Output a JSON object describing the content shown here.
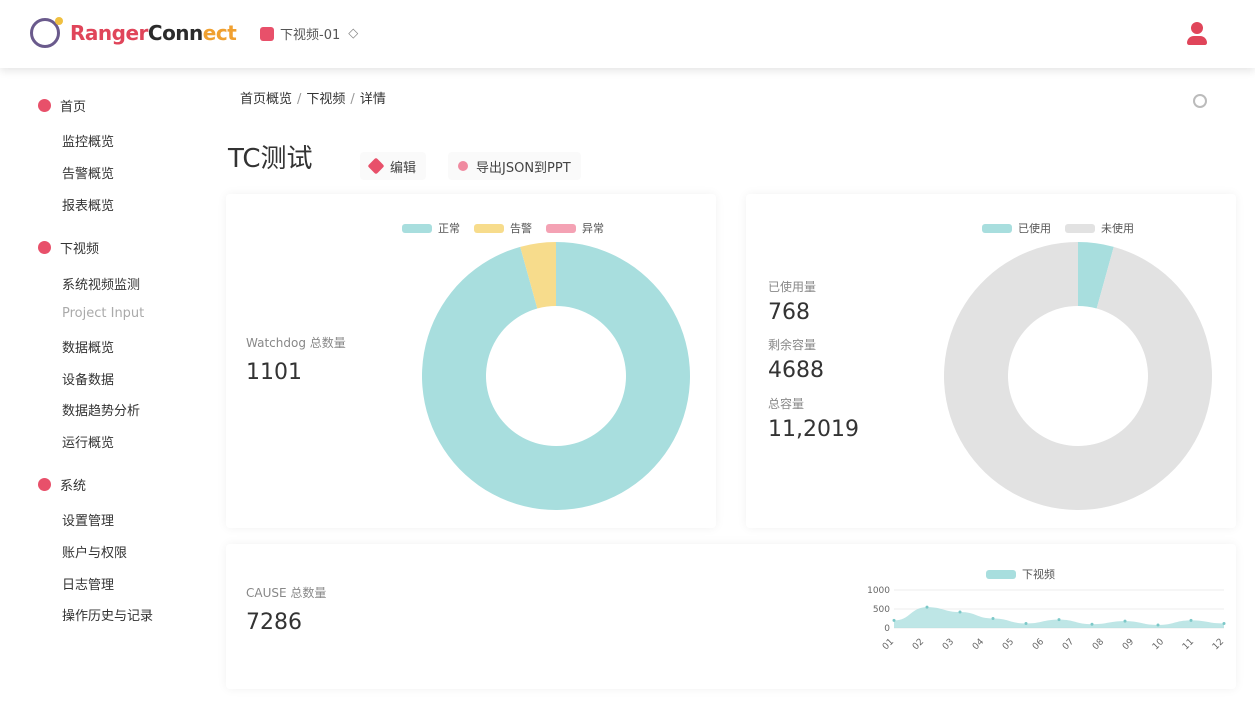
{
  "header": {
    "logo": {
      "part_a": "Ranger",
      "part_b": "Conn",
      "part_c": "ect"
    },
    "project_label": "下视频-01"
  },
  "sidebar": {
    "groups": [
      {
        "label": "首页",
        "items": [
          "监控概览",
          "告警概览",
          "报表概览"
        ]
      },
      {
        "label": "下视频",
        "items": [
          "系统视频监测",
          "Project Input",
          "数据概览",
          "设备数据",
          "数据趋势分析",
          "运行概览"
        ]
      },
      {
        "label": "系统",
        "items": [
          "设置管理",
          "账户与权限",
          "日志管理",
          "操作历史与记录"
        ]
      }
    ]
  },
  "breadcrumb": [
    "首页概览",
    "下视频",
    "详情"
  ],
  "page": {
    "title": "TC测试",
    "button_edit": "编辑",
    "button_export": "导出JSON到PPT"
  },
  "card_a": {
    "legend": [
      {
        "label": "正常",
        "color": "#a8dede"
      },
      {
        "label": "告警",
        "color": "#f7dc8c"
      },
      {
        "label": "异常",
        "color": "#f4a2b4"
      }
    ],
    "stat_label": "Watchdog 总数量",
    "stat_value": "1101",
    "donut": [
      {
        "name": "正常",
        "value": 95.7,
        "color": "#a8dede"
      },
      {
        "name": "告警",
        "value": 4.3,
        "color": "#f7dc8c"
      },
      {
        "name": "异常",
        "value": 0,
        "color": "#f4a2b4"
      }
    ]
  },
  "card_b": {
    "legend": [
      {
        "label": "已使用",
        "color": "#a8dede"
      },
      {
        "label": "未使用",
        "color": "#e2e2e2"
      }
    ],
    "stats": [
      {
        "label": "已使用量",
        "value": "768"
      },
      {
        "label": "剩余容量",
        "value": "4688"
      },
      {
        "label": "总容量",
        "value": "11,2019"
      }
    ],
    "donut": [
      {
        "name": "已使用",
        "value": 4.3,
        "color": "#a8dede"
      },
      {
        "name": "未使用",
        "value": 95.7,
        "color": "#e2e2e2"
      }
    ]
  },
  "card_c": {
    "stat_label": "CAUSE 总数量",
    "stat_value": "7286",
    "chart_legend": "下视频"
  },
  "chart_data": {
    "type": "area",
    "title": "",
    "xlabel": "",
    "ylabel": "",
    "series": [
      {
        "name": "下视频",
        "values": [
          20,
          55,
          42,
          25,
          12,
          22,
          10,
          18,
          8,
          20,
          12
        ]
      }
    ],
    "categories": [
      "01",
      "02",
      "03",
      "04",
      "05",
      "06",
      "07",
      "08",
      "09",
      "10",
      "11",
      "12"
    ],
    "yticks": [
      "1000",
      "500",
      "0"
    ],
    "ylim": [
      0,
      100
    ],
    "color": "#a8dede"
  }
}
